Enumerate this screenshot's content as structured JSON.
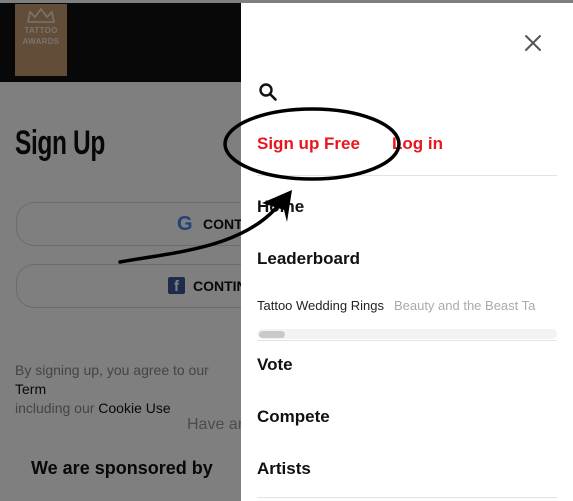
{
  "logo": {
    "line1": "TATTOO",
    "line2": "AWARDS"
  },
  "page": {
    "title": "Sign Up",
    "google_label": "CONT",
    "facebook_label": "CONTIN",
    "terms_prefix": "By signing up, you agree to our",
    "terms_link": "Term",
    "terms_mid": "including our",
    "cookie_link": "Cookie Use",
    "have_account": "Have an",
    "sponsored": "We are sponsored by"
  },
  "drawer": {
    "close_icon": "close-icon",
    "search_icon": "search-icon",
    "sign_up": "Sign up Free",
    "log_in": "Log in",
    "nav": [
      "Home",
      "Leaderboard"
    ],
    "tags": [
      "Tattoo Wedding Rings",
      "Beauty and the Beast Ta"
    ],
    "nav2": [
      "Vote",
      "Compete",
      "Artists"
    ]
  },
  "colors": {
    "accent": "#e8161e",
    "logo_bg": "#c49a72",
    "topbar": "#111111"
  }
}
